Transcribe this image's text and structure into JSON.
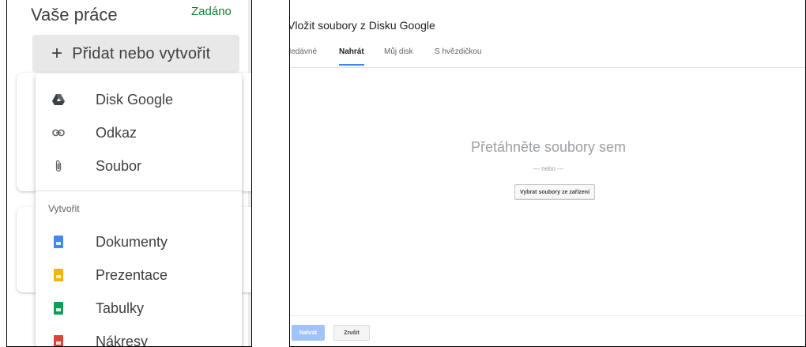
{
  "left_panel": {
    "title": "Vaše práce",
    "status": "Zadáno",
    "add_button_label": "Přidat nebo vytvořit",
    "add_button_plus": "+",
    "menu": {
      "attach_items": [
        {
          "label": "Disk Google",
          "icon": "google-drive-icon"
        },
        {
          "label": "Odkaz",
          "icon": "link-icon"
        },
        {
          "label": "Soubor",
          "icon": "paperclip-icon"
        }
      ],
      "create_section_label": "Vytvořit",
      "create_items": [
        {
          "label": "Dokumenty",
          "icon": "google-docs-icon",
          "color": "#4285f4"
        },
        {
          "label": "Prezentace",
          "icon": "google-slides-icon",
          "color": "#f4b400"
        },
        {
          "label": "Tabulky",
          "icon": "google-sheets-icon",
          "color": "#0f9d58"
        },
        {
          "label": "Nákresy",
          "icon": "google-drawings-icon",
          "color": "#db4437"
        }
      ]
    }
  },
  "picker": {
    "title": "Vložit soubory z Disku Google",
    "tabs": [
      {
        "label": "Nedávné",
        "active": false
      },
      {
        "label": "Nahrát",
        "active": true
      },
      {
        "label": "Můj disk",
        "active": false
      },
      {
        "label": "S hvězdičkou",
        "active": false
      }
    ],
    "drop_text": "Přetáhněte soubory sem",
    "or_text": "— nebo —",
    "select_button": "Vybrat soubory ze zařízení",
    "upload_button": "Nahrát",
    "cancel_button": "Zrušit"
  },
  "colors": {
    "accent": "#4285f4",
    "status_green": "#188038",
    "upload_disabled": "#9fc3fa"
  }
}
